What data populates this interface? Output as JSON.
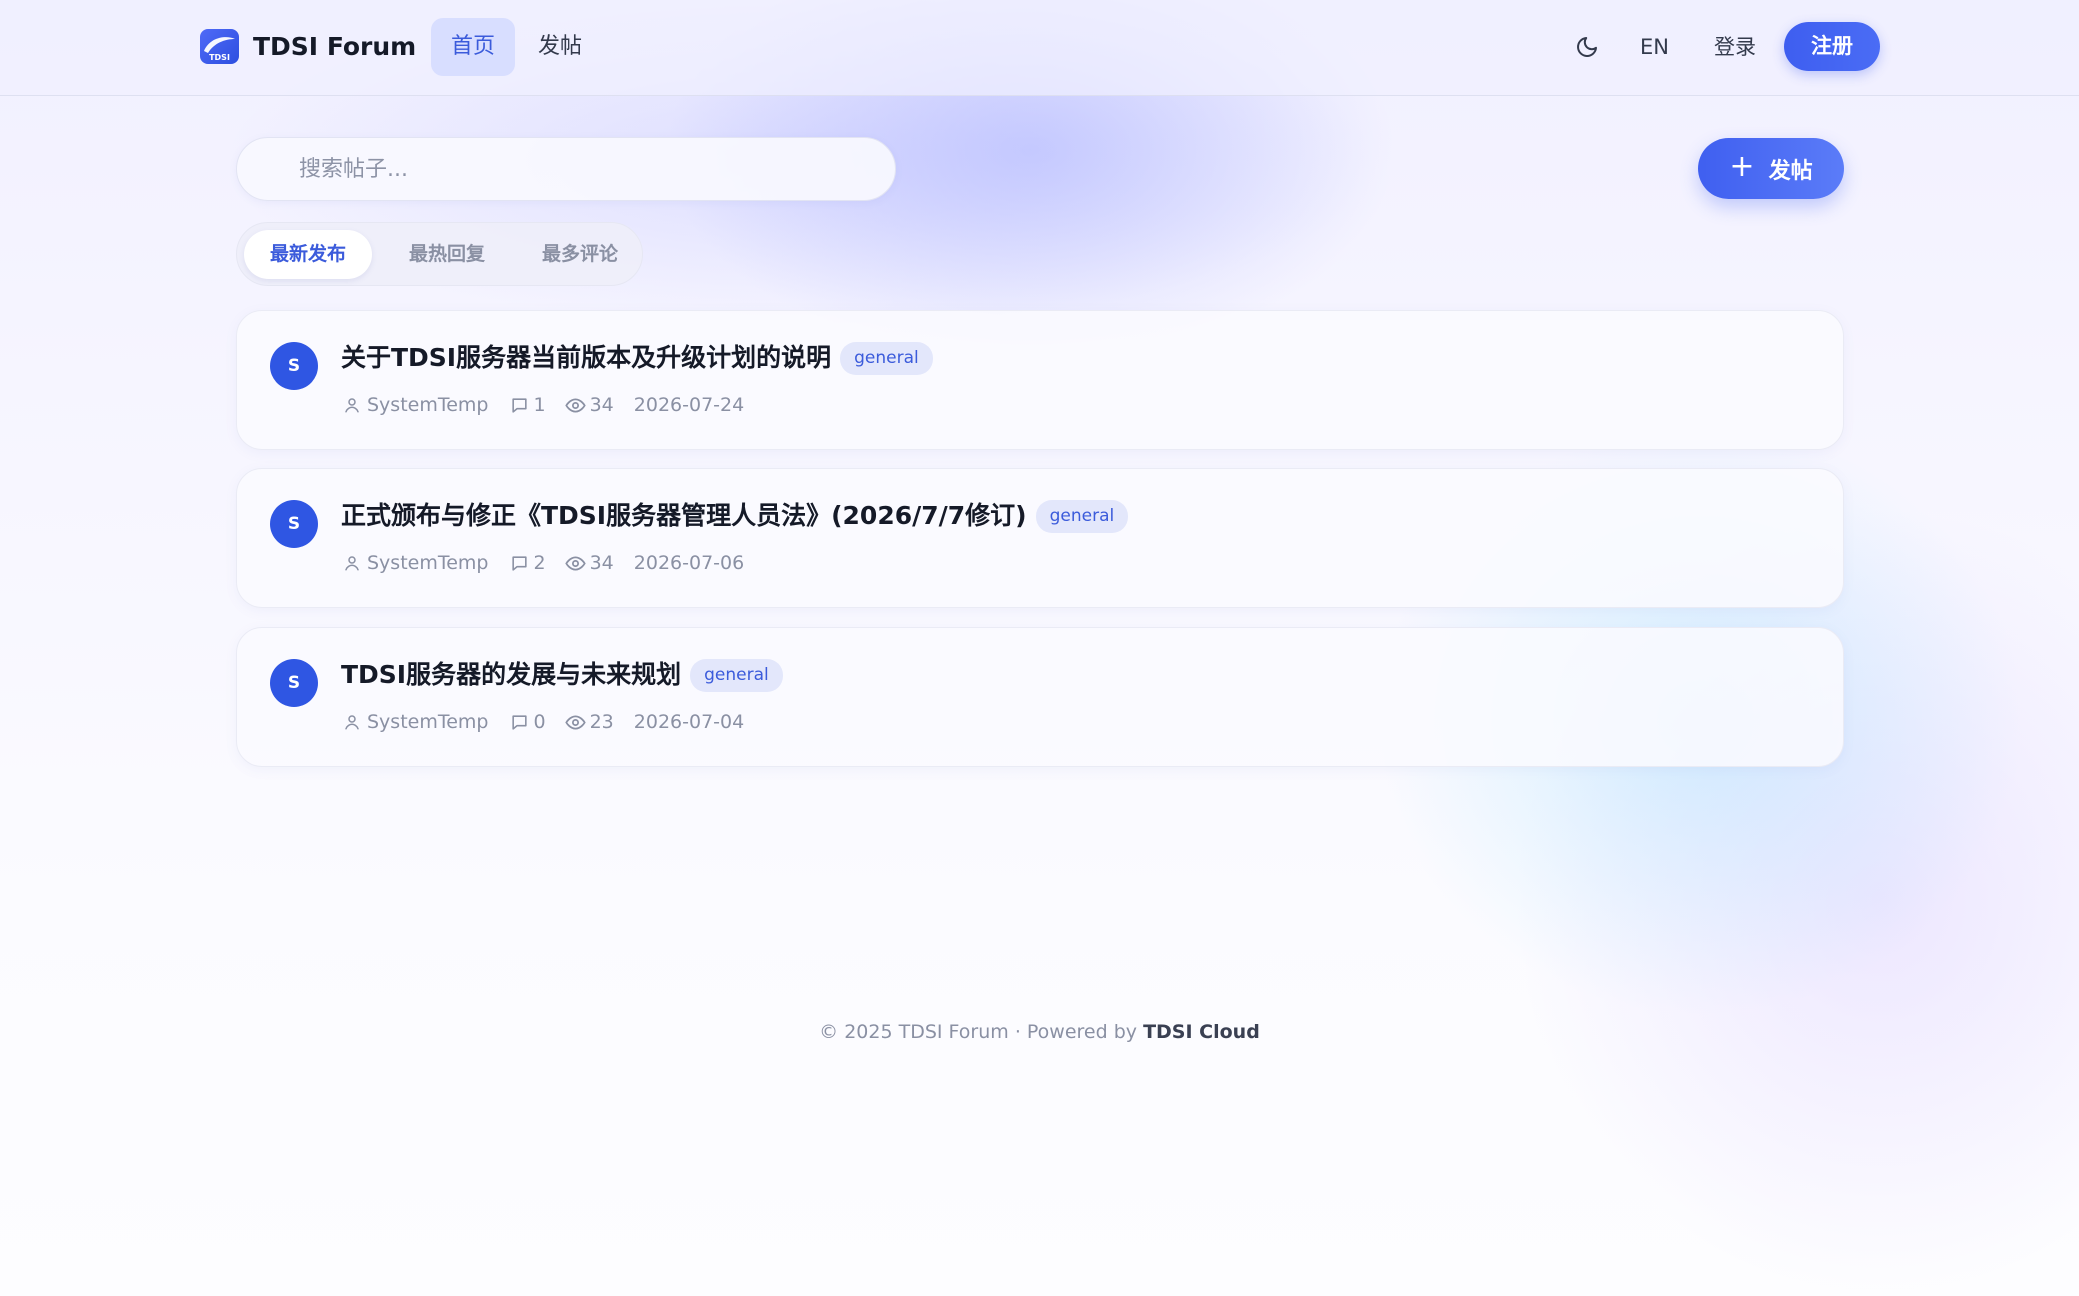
{
  "app": {
    "brand": "TDSI Forum",
    "logo_text": "TDSI"
  },
  "header": {
    "nav": [
      {
        "label": "首页",
        "active": true
      },
      {
        "label": "发帖",
        "active": false
      }
    ],
    "theme_icon": "moon-icon",
    "lang_label": "EN",
    "login_label": "登录",
    "signup_label": "注册"
  },
  "search": {
    "placeholder": "搜索帖子..."
  },
  "compose": {
    "label": "发帖",
    "icon": "plus-icon"
  },
  "tabs": [
    {
      "label": "最新发布",
      "active": true
    },
    {
      "label": "最热回复",
      "active": false
    },
    {
      "label": "最多评论",
      "active": false
    }
  ],
  "posts": [
    {
      "avatar": "S",
      "title": "关于TDSI服务器当前版本及升级计划的说明",
      "tag": "general",
      "author": "SystemTemp",
      "comments": "1",
      "views": "34",
      "date": "2026-07-24"
    },
    {
      "avatar": "S",
      "title": "正式颁布与修正《TDSI服务器管理人员法》(2026/7/7修订)",
      "tag": "general",
      "author": "SystemTemp",
      "comments": "2",
      "views": "34",
      "date": "2026-07-06"
    },
    {
      "avatar": "S",
      "title": "TDSI服务器的发展与未来规划",
      "tag": "general",
      "author": "SystemTemp",
      "comments": "0",
      "views": "23",
      "date": "2026-07-04"
    }
  ],
  "footer": {
    "text": "© 2025 TDSI Forum · Powered by ",
    "link": "TDSI Cloud"
  },
  "colors": {
    "accent": "#3b5bdb",
    "button": "#3e5ef0",
    "avatar": "#2f56e3",
    "tag_bg": "#e3e7fb"
  }
}
